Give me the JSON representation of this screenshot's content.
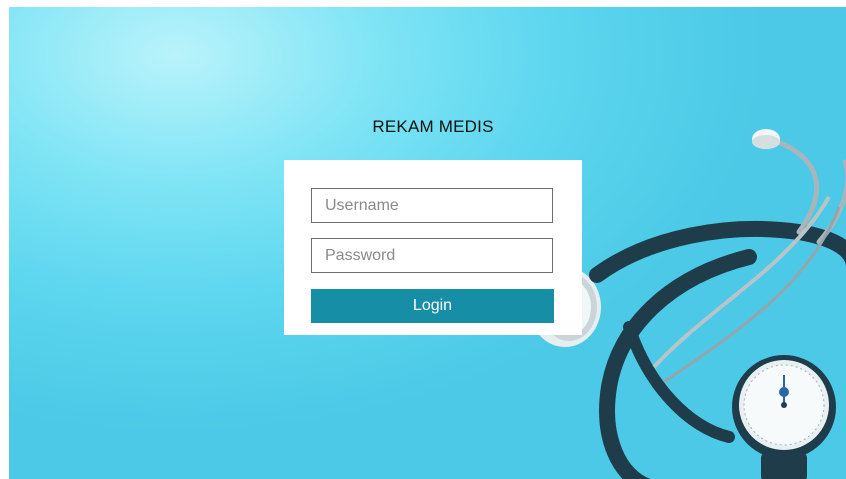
{
  "title": "REKAM MEDIS",
  "login_form": {
    "username_placeholder": "Username",
    "password_placeholder": "Password",
    "login_label": "Login"
  },
  "colors": {
    "background": "#5dd6ef",
    "button": "#168fa6",
    "card": "#ffffff"
  },
  "icons": {
    "background_image": "stethoscope-illustration"
  }
}
